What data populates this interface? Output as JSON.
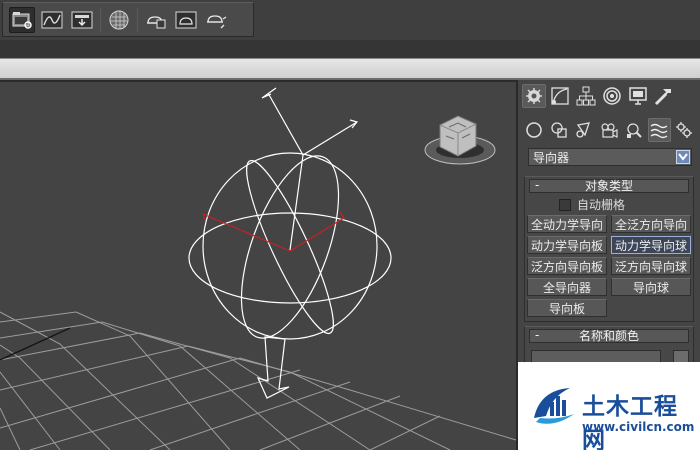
{
  "toolbar": {
    "buttons": [
      {
        "icon": "scene-explorer-icon",
        "active": true
      },
      {
        "icon": "curve-editor-icon"
      },
      {
        "icon": "schematic-view-icon"
      },
      {
        "icon": "material-editor-icon"
      },
      {
        "icon": "render-setup-icon"
      },
      {
        "icon": "rendered-frame-icon"
      },
      {
        "icon": "render-production-icon"
      }
    ]
  },
  "command_panel": {
    "main_tabs": [
      {
        "icon": "create-tab-icon",
        "active": true
      },
      {
        "icon": "modify-tab-icon"
      },
      {
        "icon": "hierarchy-tab-icon"
      },
      {
        "icon": "motion-tab-icon"
      },
      {
        "icon": "display-tab-icon"
      },
      {
        "icon": "utilities-tab-icon"
      }
    ],
    "sub_tabs": [
      {
        "icon": "geometry-icon"
      },
      {
        "icon": "shapes-icon"
      },
      {
        "icon": "lights-icon"
      },
      {
        "icon": "cameras-icon"
      },
      {
        "icon": "helpers-icon"
      },
      {
        "icon": "space-warps-icon",
        "active": true
      },
      {
        "icon": "systems-icon"
      }
    ],
    "category_dropdown": {
      "value": "导向器"
    },
    "object_type": {
      "title": "对象类型",
      "autogrid_label": "自动栅格",
      "buttons": [
        "全动力学导向",
        "全泛方向导向",
        "动力学导向板",
        "动力学导向球",
        "泛方向导向板",
        "泛方向导向球",
        "全导向器",
        "导向球",
        "导向板"
      ],
      "selected": "动力学导向球"
    },
    "name_color": {
      "title": "名称和颜色"
    }
  },
  "watermark": {
    "title": "土木工程网",
    "url": "www.civilcn.com"
  },
  "colors": {
    "wireframe": "#ffffff",
    "selection_red": "#cc2020",
    "grid": "#a0a0a0",
    "accent_blue": "#1a4e9a"
  }
}
